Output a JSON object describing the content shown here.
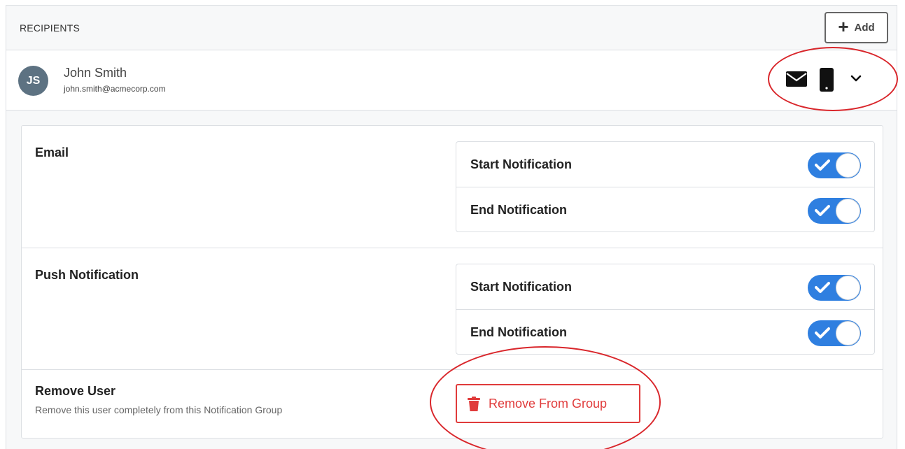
{
  "header": {
    "title": "RECIPIENTS",
    "add_label": "Add"
  },
  "user": {
    "initials": "JS",
    "name": "John Smith",
    "email": "john.smith@acmecorp.com",
    "contact_methods": [
      "mail-icon",
      "phone-icon"
    ],
    "expanded": true
  },
  "sections": [
    {
      "title": "Email",
      "toggles": [
        {
          "label": "Start Notification",
          "on": true
        },
        {
          "label": "End Notification",
          "on": true
        }
      ]
    },
    {
      "title": "Push Notification",
      "toggles": [
        {
          "label": "Start Notification",
          "on": true
        },
        {
          "label": "End Notification",
          "on": true
        }
      ]
    }
  ],
  "remove": {
    "title": "Remove User",
    "description": "Remove this user completely from this Notification Group",
    "button_label": "Remove From Group"
  },
  "colors": {
    "accent": "#2f7fe0",
    "danger": "#e03b3b",
    "annotation": "#d9262b",
    "avatar": "#5d7282"
  }
}
